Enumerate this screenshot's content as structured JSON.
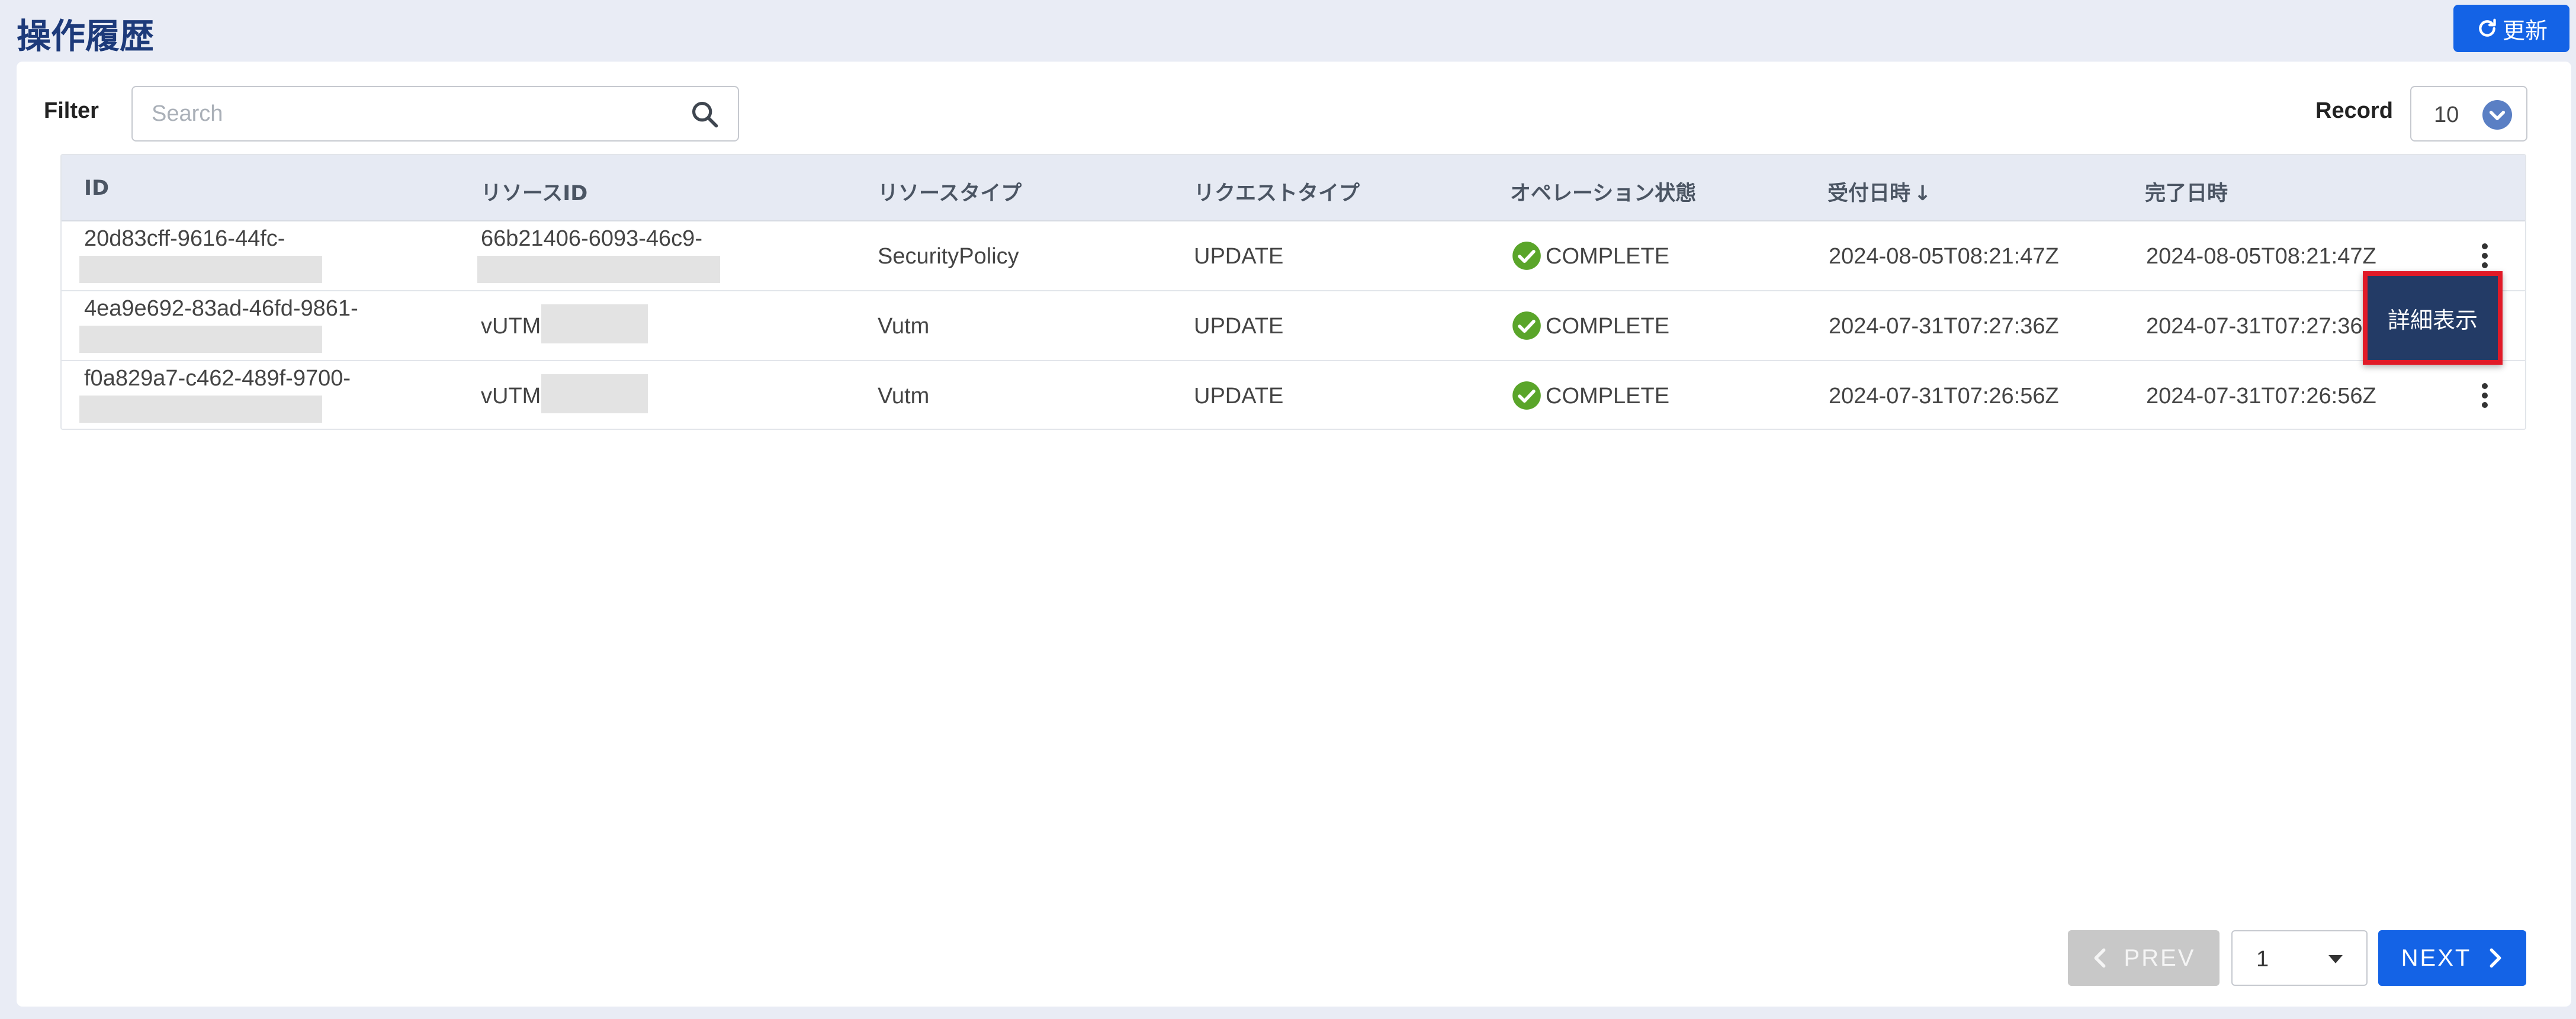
{
  "page": {
    "title": "操作履歴",
    "refresh_label": "更新"
  },
  "filter": {
    "label": "Filter",
    "search_placeholder": "Search"
  },
  "record": {
    "label": "Record",
    "value": "10"
  },
  "table": {
    "columns": [
      "ID",
      "リソースID",
      "リソースタイプ",
      "リクエストタイプ",
      "オペレーション状態",
      "受付日時",
      "完了日時"
    ],
    "sort_indicator": "↓",
    "rows": [
      {
        "id": "20d83cff-9616-44fc-",
        "resource_id": "66b21406-6093-46c9-",
        "resource_type": "SecurityPolicy",
        "request_type": "UPDATE",
        "status": "COMPLETE",
        "received": "2024-08-05T08:21:47Z",
        "completed": "2024-08-05T08:21:47Z"
      },
      {
        "id": "4ea9e692-83ad-46fd-9861-",
        "resource_id": "vUTM",
        "resource_type": "Vutm",
        "request_type": "UPDATE",
        "status": "COMPLETE",
        "received": "2024-07-31T07:27:36Z",
        "completed": "2024-07-31T07:27:36"
      },
      {
        "id": "f0a829a7-c462-489f-9700-",
        "resource_id": "vUTM",
        "resource_type": "Vutm",
        "request_type": "UPDATE",
        "status": "COMPLETE",
        "received": "2024-07-31T07:26:56Z",
        "completed": "2024-07-31T07:26:56Z"
      }
    ]
  },
  "context_menu": {
    "detail_label": "詳細表示"
  },
  "pagination": {
    "prev_label": "PREV",
    "page_value": "1",
    "next_label": "NEXT"
  },
  "colors": {
    "title": "#1d3a7a",
    "primary": "#1463e6",
    "status_ok": "#5aa52a",
    "highlight": "#e11a27",
    "menu_bg": "#233b66"
  },
  "icons": {
    "refresh": "refresh-icon",
    "search": "search-icon",
    "status": "check-circle-icon",
    "row_menu": "kebab-menu-icon"
  }
}
